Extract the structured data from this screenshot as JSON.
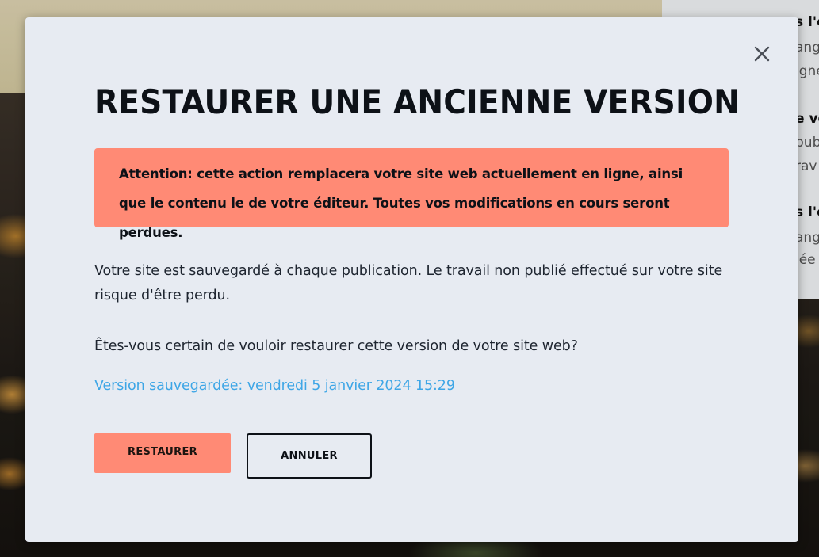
{
  "background": {
    "side_panel_lines": [
      {
        "text": "s l'é",
        "style": "bold"
      },
      {
        "text": "ang",
        "style": "gray"
      },
      {
        "text": "igne",
        "style": "gray"
      },
      {
        "text": "e ve",
        "style": "bold"
      },
      {
        "text": "pub",
        "style": "gray"
      },
      {
        "text": "rav",
        "style": "gray"
      },
      {
        "text": "s l'é",
        "style": "bold"
      },
      {
        "text": "ang",
        "style": "gray"
      },
      {
        "text": "iée",
        "style": "gray"
      }
    ]
  },
  "modal": {
    "title": "RESTAURER UNE ANCIENNE VERSION",
    "close_icon": "close-icon",
    "warning": "Attention: cette action remplacera votre site web actuellement en ligne, ainsi que le contenu le de votre éditeur. Toutes vos modifications en cours seront perdues.",
    "paragraph_1": "Votre site est sauvegardé à chaque publication. Le travail non publié effectué sur votre site risque d'être perdu.",
    "paragraph_2": "Êtes-vous certain de vouloir restaurer cette version de votre site web?",
    "version_label": "Version sauvegardée: vendredi 5 janvier 2024 15:29",
    "restore_button": "RESTAURER",
    "cancel_button": "ANNULER"
  },
  "colors": {
    "modal_bg": "#e7ebf2",
    "accent": "#ff8a75",
    "link": "#3ea6e6",
    "text": "#0d1117"
  }
}
